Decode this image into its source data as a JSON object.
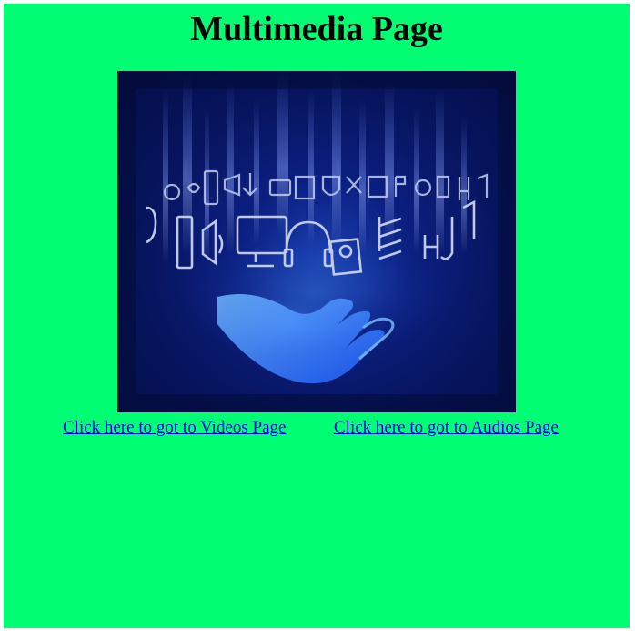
{
  "page": {
    "title": "Multimedia Page",
    "background_color": "#00ff73"
  },
  "hero_image": {
    "icon": "multimedia-hand-icons-image"
  },
  "links": {
    "videos": "Click here to got to Videos Page",
    "audios": "Click here to got to Audios Page",
    "color": "#0000ee"
  }
}
